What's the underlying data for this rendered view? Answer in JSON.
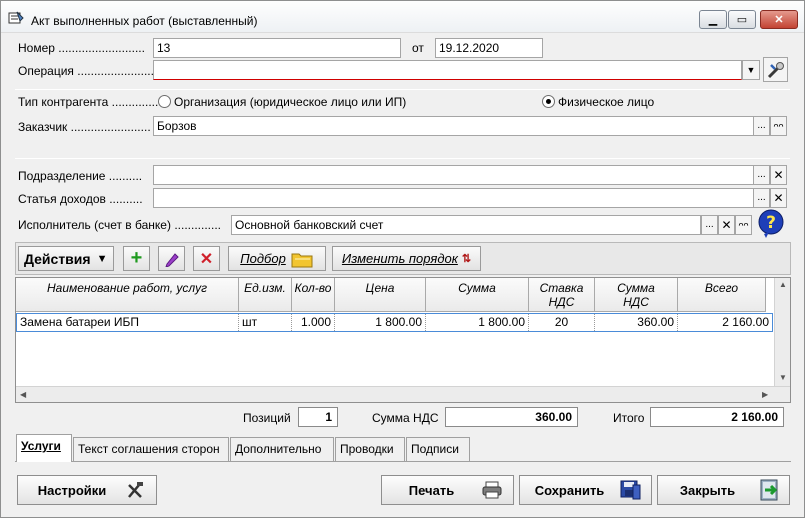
{
  "window": {
    "title": "Акт выполненных работ (выставленный)"
  },
  "form": {
    "number_label": "Номер",
    "number_value": "13",
    "date_label": "от",
    "date_value": "19.12.2020",
    "operation_label": "Операция",
    "operation_value": "",
    "contractor_type_label": "Тип контрагента",
    "option_org": "Организация (юридическое лицо или ИП)",
    "option_person": "Физическое лицо",
    "selected_option": "person",
    "customer_label": "Заказчик",
    "customer_value": "Борзов",
    "division_label": "Подразделение",
    "division_value": "",
    "income_label": "Статья доходов",
    "income_value": "",
    "executor_label": "Исполнитель (счет в банке)",
    "executor_value": "Основной банковский счет"
  },
  "toolbar": {
    "actions": "Действия",
    "select": "Подбор",
    "reorder": "Изменить порядок"
  },
  "grid": {
    "columns": [
      "Наименование работ, услуг",
      "Ед.изм.",
      "Кол-во",
      "Цена",
      "Сумма",
      "Ставка НДС",
      "Сумма НДС",
      "Всего"
    ],
    "rows": [
      {
        "name": "Замена батареи ИБП",
        "unit": "шт",
        "qty": "1.000",
        "price": "1 800.00",
        "sum": "1 800.00",
        "vat_rate": "20",
        "vat_sum": "360.00",
        "total": "2 160.00"
      }
    ]
  },
  "totals": {
    "positions_label": "Позиций",
    "positions_value": "1",
    "vat_label": "Сумма НДС",
    "vat_value": "360.00",
    "total_label": "Итого",
    "total_value": "2 160.00"
  },
  "tabs": [
    "Услуги",
    "Текст соглашения сторон",
    "Дополнительно",
    "Проводки",
    "Подписи"
  ],
  "buttons": {
    "settings": "Настройки",
    "print": "Печать",
    "save": "Сохранить",
    "close": "Закрыть"
  }
}
